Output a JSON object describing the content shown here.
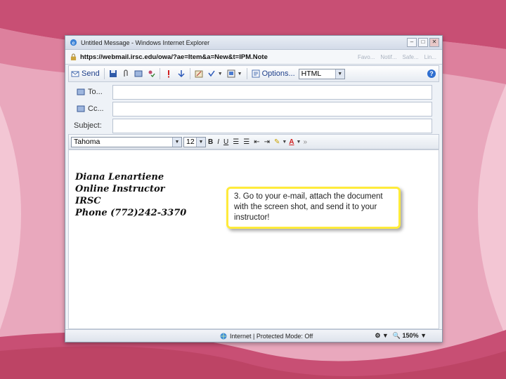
{
  "window": {
    "title": "Untitled Message - Windows Internet Explorer"
  },
  "address": {
    "url": "https://webmail.irsc.edu/owa/?ae=Item&a=New&t=IPM.Note",
    "ghost_items": [
      "Favo...",
      "Notif...",
      "Safe...",
      "Lin..."
    ]
  },
  "toolbar": {
    "send_label": "Send",
    "options_label": "Options...",
    "format_value": "HTML"
  },
  "headers": {
    "to_label": "To...",
    "cc_label": "Cc...",
    "subject_label": "Subject:"
  },
  "formatbar": {
    "font_value": "Tahoma",
    "size_value": "12"
  },
  "signature": [
    "Diana Lenartiene",
    "Online Instructor",
    "IRSC",
    "Phone (772)242-3370"
  ],
  "callout": {
    "text": "3. Go to your e-mail, attach the document with the screen shot, and send it to your instructor!"
  },
  "status": {
    "mode": "Internet | Protected Mode: Off",
    "zoom": "150%"
  },
  "colors": {
    "accent": "#2f6fd0",
    "callout_border": "#ffeb3b",
    "background": "#e9a8bd"
  }
}
